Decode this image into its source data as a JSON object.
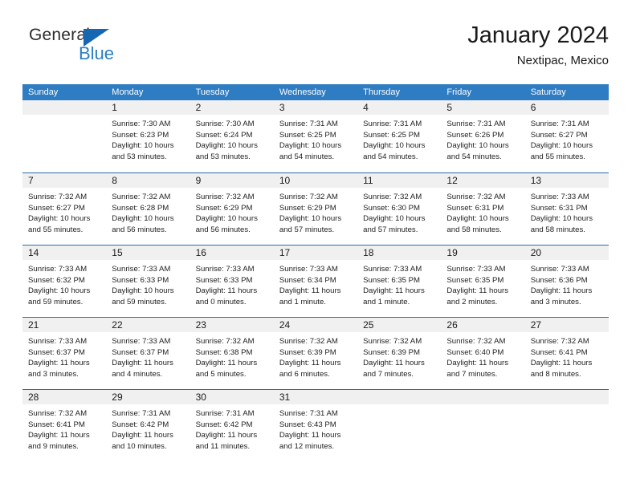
{
  "logo": {
    "primary_text": "General",
    "secondary_text": "Blue",
    "triangle_icon": "blue-triangle-icon",
    "primary_color": "#2b2b2b",
    "secondary_color": "#2b7fc4"
  },
  "header": {
    "title": "January 2024",
    "subtitle": "Nextipac, Mexico"
  },
  "colors": {
    "header_bar": "#2e7cc1",
    "week_divider": "#2e6da4",
    "daynum_band": "#f0f0f0",
    "page_background": "#ffffff"
  },
  "calendar": {
    "weekday_headers": [
      "Sunday",
      "Monday",
      "Tuesday",
      "Wednesday",
      "Thursday",
      "Friday",
      "Saturday"
    ],
    "weeks": [
      [
        {
          "day": "",
          "sunrise": "",
          "sunset": "",
          "daylight": "",
          "empty": true
        },
        {
          "day": "1",
          "sunrise": "Sunrise: 7:30 AM",
          "sunset": "Sunset: 6:23 PM",
          "daylight": "Daylight: 10 hours and 53 minutes."
        },
        {
          "day": "2",
          "sunrise": "Sunrise: 7:30 AM",
          "sunset": "Sunset: 6:24 PM",
          "daylight": "Daylight: 10 hours and 53 minutes."
        },
        {
          "day": "3",
          "sunrise": "Sunrise: 7:31 AM",
          "sunset": "Sunset: 6:25 PM",
          "daylight": "Daylight: 10 hours and 54 minutes."
        },
        {
          "day": "4",
          "sunrise": "Sunrise: 7:31 AM",
          "sunset": "Sunset: 6:25 PM",
          "daylight": "Daylight: 10 hours and 54 minutes."
        },
        {
          "day": "5",
          "sunrise": "Sunrise: 7:31 AM",
          "sunset": "Sunset: 6:26 PM",
          "daylight": "Daylight: 10 hours and 54 minutes."
        },
        {
          "day": "6",
          "sunrise": "Sunrise: 7:31 AM",
          "sunset": "Sunset: 6:27 PM",
          "daylight": "Daylight: 10 hours and 55 minutes."
        }
      ],
      [
        {
          "day": "7",
          "sunrise": "Sunrise: 7:32 AM",
          "sunset": "Sunset: 6:27 PM",
          "daylight": "Daylight: 10 hours and 55 minutes."
        },
        {
          "day": "8",
          "sunrise": "Sunrise: 7:32 AM",
          "sunset": "Sunset: 6:28 PM",
          "daylight": "Daylight: 10 hours and 56 minutes."
        },
        {
          "day": "9",
          "sunrise": "Sunrise: 7:32 AM",
          "sunset": "Sunset: 6:29 PM",
          "daylight": "Daylight: 10 hours and 56 minutes."
        },
        {
          "day": "10",
          "sunrise": "Sunrise: 7:32 AM",
          "sunset": "Sunset: 6:29 PM",
          "daylight": "Daylight: 10 hours and 57 minutes."
        },
        {
          "day": "11",
          "sunrise": "Sunrise: 7:32 AM",
          "sunset": "Sunset: 6:30 PM",
          "daylight": "Daylight: 10 hours and 57 minutes."
        },
        {
          "day": "12",
          "sunrise": "Sunrise: 7:32 AM",
          "sunset": "Sunset: 6:31 PM",
          "daylight": "Daylight: 10 hours and 58 minutes."
        },
        {
          "day": "13",
          "sunrise": "Sunrise: 7:33 AM",
          "sunset": "Sunset: 6:31 PM",
          "daylight": "Daylight: 10 hours and 58 minutes."
        }
      ],
      [
        {
          "day": "14",
          "sunrise": "Sunrise: 7:33 AM",
          "sunset": "Sunset: 6:32 PM",
          "daylight": "Daylight: 10 hours and 59 minutes."
        },
        {
          "day": "15",
          "sunrise": "Sunrise: 7:33 AM",
          "sunset": "Sunset: 6:33 PM",
          "daylight": "Daylight: 10 hours and 59 minutes."
        },
        {
          "day": "16",
          "sunrise": "Sunrise: 7:33 AM",
          "sunset": "Sunset: 6:33 PM",
          "daylight": "Daylight: 11 hours and 0 minutes."
        },
        {
          "day": "17",
          "sunrise": "Sunrise: 7:33 AM",
          "sunset": "Sunset: 6:34 PM",
          "daylight": "Daylight: 11 hours and 1 minute."
        },
        {
          "day": "18",
          "sunrise": "Sunrise: 7:33 AM",
          "sunset": "Sunset: 6:35 PM",
          "daylight": "Daylight: 11 hours and 1 minute."
        },
        {
          "day": "19",
          "sunrise": "Sunrise: 7:33 AM",
          "sunset": "Sunset: 6:35 PM",
          "daylight": "Daylight: 11 hours and 2 minutes."
        },
        {
          "day": "20",
          "sunrise": "Sunrise: 7:33 AM",
          "sunset": "Sunset: 6:36 PM",
          "daylight": "Daylight: 11 hours and 3 minutes."
        }
      ],
      [
        {
          "day": "21",
          "sunrise": "Sunrise: 7:33 AM",
          "sunset": "Sunset: 6:37 PM",
          "daylight": "Daylight: 11 hours and 3 minutes."
        },
        {
          "day": "22",
          "sunrise": "Sunrise: 7:33 AM",
          "sunset": "Sunset: 6:37 PM",
          "daylight": "Daylight: 11 hours and 4 minutes."
        },
        {
          "day": "23",
          "sunrise": "Sunrise: 7:32 AM",
          "sunset": "Sunset: 6:38 PM",
          "daylight": "Daylight: 11 hours and 5 minutes."
        },
        {
          "day": "24",
          "sunrise": "Sunrise: 7:32 AM",
          "sunset": "Sunset: 6:39 PM",
          "daylight": "Daylight: 11 hours and 6 minutes."
        },
        {
          "day": "25",
          "sunrise": "Sunrise: 7:32 AM",
          "sunset": "Sunset: 6:39 PM",
          "daylight": "Daylight: 11 hours and 7 minutes."
        },
        {
          "day": "26",
          "sunrise": "Sunrise: 7:32 AM",
          "sunset": "Sunset: 6:40 PM",
          "daylight": "Daylight: 11 hours and 7 minutes."
        },
        {
          "day": "27",
          "sunrise": "Sunrise: 7:32 AM",
          "sunset": "Sunset: 6:41 PM",
          "daylight": "Daylight: 11 hours and 8 minutes."
        }
      ],
      [
        {
          "day": "28",
          "sunrise": "Sunrise: 7:32 AM",
          "sunset": "Sunset: 6:41 PM",
          "daylight": "Daylight: 11 hours and 9 minutes."
        },
        {
          "day": "29",
          "sunrise": "Sunrise: 7:31 AM",
          "sunset": "Sunset: 6:42 PM",
          "daylight": "Daylight: 11 hours and 10 minutes."
        },
        {
          "day": "30",
          "sunrise": "Sunrise: 7:31 AM",
          "sunset": "Sunset: 6:42 PM",
          "daylight": "Daylight: 11 hours and 11 minutes."
        },
        {
          "day": "31",
          "sunrise": "Sunrise: 7:31 AM",
          "sunset": "Sunset: 6:43 PM",
          "daylight": "Daylight: 11 hours and 12 minutes."
        },
        {
          "day": "",
          "sunrise": "",
          "sunset": "",
          "daylight": "",
          "empty": true
        },
        {
          "day": "",
          "sunrise": "",
          "sunset": "",
          "daylight": "",
          "empty": true
        },
        {
          "day": "",
          "sunrise": "",
          "sunset": "",
          "daylight": "",
          "empty": true
        }
      ]
    ]
  }
}
